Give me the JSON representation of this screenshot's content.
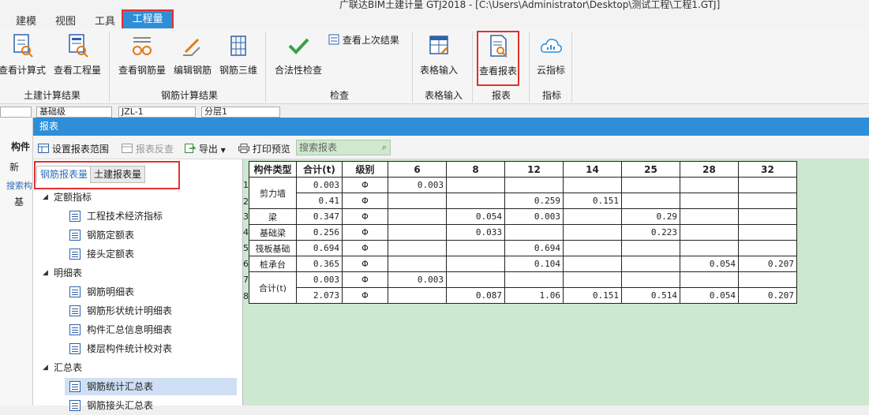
{
  "app": {
    "title": "广联达BIM土建计量 GTJ2018 - [C:\\Users\\Administrator\\Desktop\\测试工程\\工程1.GTJ]"
  },
  "menu": [
    "建模",
    "视图",
    "工具",
    "工程量"
  ],
  "ribbon": {
    "buttons": [
      {
        "label": "查看计算式",
        "icon": "formula-icon"
      },
      {
        "label": "查看工程量",
        "icon": "quantity-icon"
      },
      {
        "label": "查看钢筋量",
        "icon": "rebar-glasses-icon"
      },
      {
        "label": "编辑钢筋",
        "icon": "edit-rebar-icon"
      },
      {
        "label": "钢筋三维",
        "icon": "rebar-3d-icon"
      },
      {
        "label": "合法性检查",
        "icon": "checkmark-icon"
      },
      {
        "label": "查看上次结果",
        "icon": "last-result-icon"
      },
      {
        "label": "表格输入",
        "icon": "table-input-icon"
      },
      {
        "label": "查看报表",
        "icon": "report-icon"
      },
      {
        "label": "云指标",
        "icon": "cloud-icon"
      }
    ],
    "groups": [
      "土建计算结果",
      "钢筋计算结果",
      "检查",
      "表格输入",
      "报表",
      "指标"
    ]
  },
  "selectors": [
    "基础级",
    "JZL-1",
    "分层1"
  ],
  "left_col": {
    "header": "构件",
    "new_label": "新",
    "search": "搜索构",
    "tree": "基"
  },
  "dialog": {
    "title": "报表",
    "toolbar": {
      "range": "设置报表范围",
      "reverse": "报表反查",
      "export": "导出",
      "print": "打印预览",
      "search_placeholder": "搜索报表"
    },
    "tabs": [
      "钢筋报表量",
      "土建报表量"
    ],
    "tree": [
      {
        "type": "group",
        "label": "定额指标"
      },
      {
        "type": "item",
        "label": "工程技术经济指标"
      },
      {
        "type": "item",
        "label": "钢筋定额表"
      },
      {
        "type": "item",
        "label": "接头定额表"
      },
      {
        "type": "group",
        "label": "明细表"
      },
      {
        "type": "item",
        "label": "钢筋明细表"
      },
      {
        "type": "item",
        "label": "钢筋形状统计明细表"
      },
      {
        "type": "item",
        "label": "构件汇总信息明细表"
      },
      {
        "type": "item",
        "label": "楼层构件统计校对表"
      },
      {
        "type": "group",
        "label": "汇总表"
      },
      {
        "type": "item",
        "label": "钢筋统计汇总表",
        "selected": true
      },
      {
        "type": "item",
        "label": "钢筋接头汇总表"
      }
    ]
  },
  "report": {
    "headers": [
      "构件类型",
      "合计(t)",
      "级别",
      "6",
      "8",
      "12",
      "14",
      "25",
      "28",
      "32"
    ],
    "groups": [
      {
        "type": "剪力墙",
        "rows": [
          {
            "num": "1",
            "total": "0.003",
            "grade": "Φ",
            "v": [
              "0.003",
              "",
              "",
              "",
              "",
              "",
              ""
            ]
          },
          {
            "num": "2",
            "total": "0.41",
            "grade": "Φ",
            "v": [
              "",
              "",
              "0.259",
              "0.151",
              "",
              "",
              ""
            ]
          }
        ]
      },
      {
        "type": "梁",
        "rows": [
          {
            "num": "3",
            "total": "0.347",
            "grade": "Φ",
            "v": [
              "",
              "0.054",
              "0.003",
              "",
              "0.29",
              "",
              ""
            ]
          }
        ]
      },
      {
        "type": "基础梁",
        "rows": [
          {
            "num": "4",
            "total": "0.256",
            "grade": "Φ",
            "v": [
              "",
              "0.033",
              "",
              "",
              "0.223",
              "",
              ""
            ]
          }
        ]
      },
      {
        "type": "筏板基础",
        "rows": [
          {
            "num": "5",
            "total": "0.694",
            "grade": "Φ",
            "v": [
              "",
              "",
              "0.694",
              "",
              "",
              "",
              ""
            ]
          }
        ]
      },
      {
        "type": "桩承台",
        "rows": [
          {
            "num": "6",
            "total": "0.365",
            "grade": "Φ",
            "v": [
              "",
              "",
              "0.104",
              "",
              "",
              "0.054",
              "0.207"
            ]
          }
        ]
      },
      {
        "type": "合计(t)",
        "rows": [
          {
            "num": "7",
            "total": "0.003",
            "grade": "Φ",
            "v": [
              "0.003",
              "",
              "",
              "",
              "",
              "",
              ""
            ]
          },
          {
            "num": "8",
            "total": "2.073",
            "grade": "Φ",
            "v": [
              "",
              "0.087",
              "1.06",
              "0.151",
              "0.514",
              "0.054",
              "0.207"
            ]
          }
        ]
      }
    ]
  },
  "colors": {
    "accent": "#2e8fd8",
    "highlight_red": "#e03030",
    "green_bg": "#cde8d0",
    "search_bg": "#cfe8cf"
  }
}
